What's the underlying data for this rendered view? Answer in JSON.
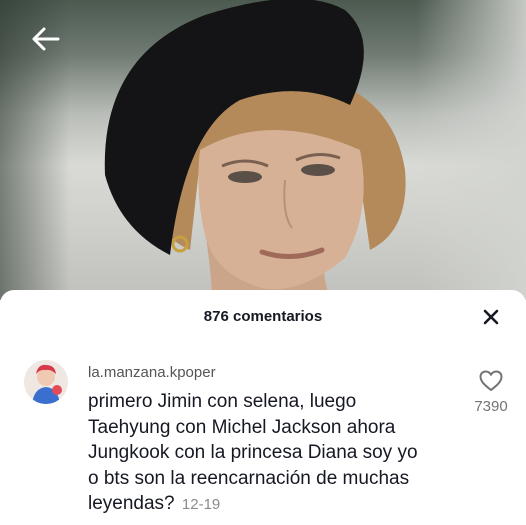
{
  "video": {
    "back_icon": "back-arrow-icon"
  },
  "comments_sheet": {
    "title": "876 comentarios",
    "close_icon": "close-icon"
  },
  "comment": {
    "username": "la.manzana.kpoper",
    "text": "primero Jimin con selena, luego Taehyung con Michel Jackson ahora Jungkook con la princesa Diana soy yo o bts son la reencarnación de muchas leyendas?",
    "date": "12-19",
    "like_count": "7390",
    "like_icon": "heart-outline-icon"
  },
  "colors": {
    "sheet_background": "#ffffff",
    "primary_text": "#161823",
    "secondary_text": "#8a8b91"
  }
}
